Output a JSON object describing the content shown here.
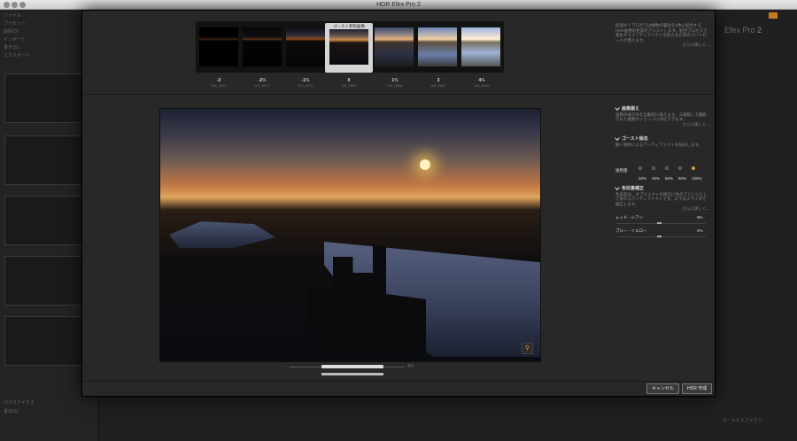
{
  "window": {
    "title": "HDR Efex Pro 2"
  },
  "background": {
    "left_menu": [
      "ファイル",
      "プリセット",
      "削除(D)",
      "インポート",
      "書き出し",
      "エクスポート"
    ],
    "bottom_menu": [
      "ロクステイタス",
      "書出(S)"
    ],
    "right_brand": "Efex Pro",
    "right_brand_version": "2",
    "bottom_right_label": "ルールとエフェクト"
  },
  "exposures": [
    {
      "ev": "-3",
      "file": "DJI_0073"
    },
    {
      "ev": "-2⅓",
      "file": "DJI_0071"
    },
    {
      "ev": "-1⅓",
      "file": "DJI_0070"
    },
    {
      "ev": "0",
      "file": "DJI_0069",
      "selected": true,
      "caption": "ゴースト参照画像"
    },
    {
      "ev": "1⅓",
      "file": "DJI_0068"
    },
    {
      "ev": "3",
      "file": "DJI_0067"
    },
    {
      "ev": "4⅓",
      "file": "DJI_0066"
    }
  ],
  "intro": {
    "text": "処理ダイアログでは複数の露出を1枚に結合するHDR画像の生成をアシストします。結合プロセスで発生するアーティファクトを抑えるためのコントロールが使えます。",
    "more": "さらに詳しく..."
  },
  "align": {
    "title": "画像揃え",
    "text": "画像の被写体を自動的に揃えます。三脚無しで撮影された複数のショットに対応できます。",
    "more": "さらに詳しく..."
  },
  "ghost": {
    "title": "ゴースト除去",
    "text": "動く物体によるアーティファクトを除去します。",
    "more": "さらに詳しく...",
    "amount_label": "適用量",
    "amounts": [
      "20%",
      "40%",
      "60%",
      "80%",
      "100%"
    ],
    "selected_index": 4
  },
  "chromatic": {
    "title": "色収差補正",
    "text": "色収差は、オブジェクトの周辺に色のフリンジとして現れるアーティファクトです。以下のスライダで補正します。",
    "more": "さらに詳しく...",
    "red_cyan_label": "レッド - シアン",
    "red_cyan_value": "0%",
    "blue_yellow_label": "ブルー - イエロー",
    "blue_yellow_value": "0%"
  },
  "zoom": {
    "min_label": "-",
    "max_label": "4⅓"
  },
  "buttons": {
    "cancel": "キャンセル",
    "create": "HDR 作成"
  },
  "colors": {
    "accent": "#d9a040",
    "dialog_bg": "#282828"
  },
  "icons": {
    "zoom": "magnifier-icon"
  }
}
